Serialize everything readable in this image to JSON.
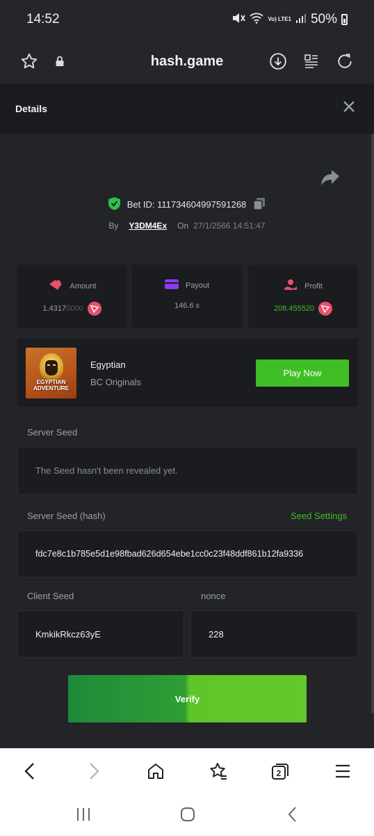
{
  "status_bar": {
    "time": "14:52",
    "network": "Vo) LTE1",
    "battery": "50%"
  },
  "browser": {
    "url": "hash.game",
    "icons": [
      "star-icon",
      "lock-icon",
      "download-icon",
      "reader-icon",
      "refresh-icon"
    ]
  },
  "details": {
    "title": "Details"
  },
  "bet": {
    "id_label": "Bet ID:",
    "id_value": "111734604997591268",
    "by_label": "By",
    "user": "Y3DM4Ex",
    "on_label": "On",
    "datetime": "27/1/2566 14:51:47"
  },
  "stats": {
    "amount": {
      "label": "Amount",
      "value_main": "1.4317",
      "value_faded": "0000"
    },
    "payout": {
      "label": "Payout",
      "value": "146.6 x"
    },
    "profit": {
      "label": "Profit",
      "value": "208.455520"
    }
  },
  "game": {
    "thumb_text_1": "EGYPTIAN",
    "thumb_text_2": "ADVENTURE",
    "name": "Egyptian",
    "provider": "BC Originals",
    "play_label": "Play Now"
  },
  "server_seed": {
    "label": "Server Seed",
    "value": "The Seed hasn't been revealed yet."
  },
  "server_seed_hash": {
    "label": "Server Seed (hash)",
    "settings_label": "Seed Settings",
    "value": "fdc7e8c1b785e5d1e98fbad626d654ebe1cc0c23f48ddf861b12fa9336"
  },
  "client_seed": {
    "label": "Client Seed",
    "value": "KmkikRkcz63yE"
  },
  "nonce": {
    "label": "nonce",
    "value": "228"
  },
  "verify_label": "Verify",
  "bottom_nav": {
    "tabs_count": "2"
  },
  "colors": {
    "accent_green": "#3fbe25",
    "coin_red": "#e94f6d",
    "payout_purple": "#8b3cf5"
  }
}
